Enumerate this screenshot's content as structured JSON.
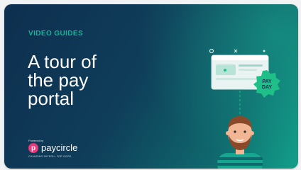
{
  "card": {
    "eyebrow": "VIDEO GUIDES",
    "headline": [
      "A tour of",
      "the pay",
      "portal"
    ],
    "powered_by": "Powered by",
    "brand": {
      "logo_letter": "p",
      "name": "paycircle",
      "tagline": "CHANGING PAYROLL FOR GOOD"
    },
    "badge": [
      "PAY",
      "DAY"
    ]
  },
  "colors": {
    "eyebrow": "#16b39a",
    "accent_pink": "#e63a7a",
    "badge_green": "#1fbf88"
  }
}
